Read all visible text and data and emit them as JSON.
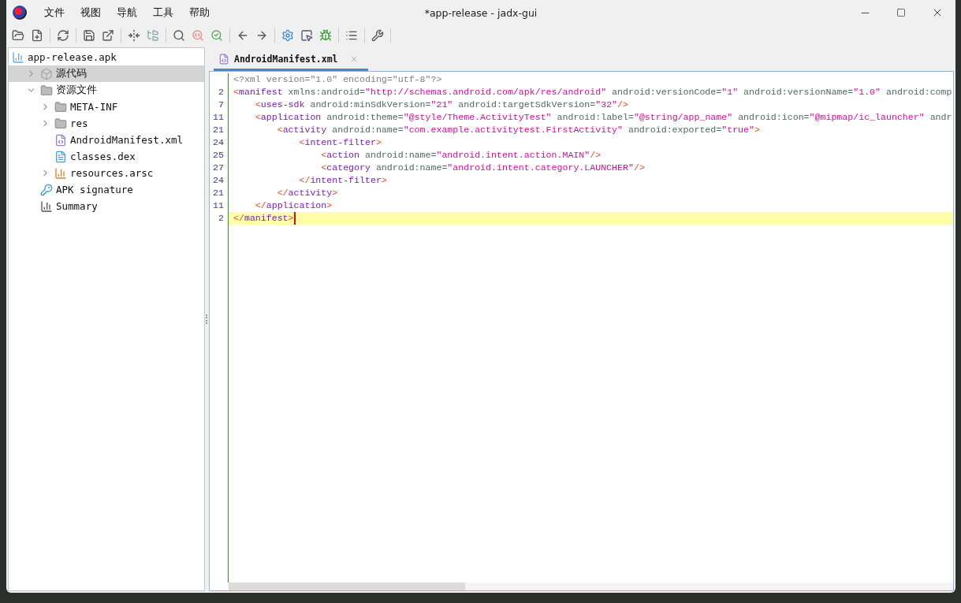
{
  "window": {
    "title": "*app-release - jadx-gui"
  },
  "menu": [
    "文件",
    "视图",
    "导航",
    "工具",
    "帮助"
  ],
  "tree": {
    "label": "app-release.apk",
    "kind": "apk",
    "children": [
      {
        "label": "源代码",
        "kind": "package",
        "expanded": false,
        "selected": true
      },
      {
        "label": "资源文件",
        "kind": "resources",
        "expanded": true,
        "selected": false,
        "children": [
          {
            "label": "META-INF",
            "kind": "folder",
            "expanded": false,
            "selected": false
          },
          {
            "label": "res",
            "kind": "folder",
            "expanded": false,
            "selected": false
          },
          {
            "label": "AndroidManifest.xml",
            "kind": "manifest",
            "selected": false
          },
          {
            "label": "classes.dex",
            "kind": "dex",
            "selected": false
          },
          {
            "label": "resources.arsc",
            "kind": "arsc",
            "expanded": false,
            "selected": false
          }
        ]
      },
      {
        "label": "APK signature",
        "kind": "signature",
        "selected": false
      },
      {
        "label": "Summary",
        "kind": "summary",
        "selected": false
      }
    ]
  },
  "tabs": [
    {
      "label": "AndroidManifest.xml",
      "selected": true
    }
  ],
  "code_lines": [
    {
      "tokens": [
        {
          "kind": "decl",
          "text": "<?xml version=\"1.0\" encoding=\"utf-8\"?>"
        }
      ],
      "current": false
    },
    {
      "number": "2",
      "tokens": [
        {
          "kind": "punct",
          "text": "<"
        },
        {
          "kind": "tag",
          "text": "manifest"
        },
        {
          "kind": "attr",
          "text": " xmlns:android="
        },
        {
          "kind": "value",
          "text": "\"http://schemas.android.com/apk/res/android\""
        },
        {
          "kind": "attr",
          "text": " android:versionCode="
        },
        {
          "kind": "value",
          "text": "\"1\""
        },
        {
          "kind": "attr",
          "text": " android:versionName="
        },
        {
          "kind": "value",
          "text": "\"1.0\""
        },
        {
          "kind": "attr",
          "text": " android:comp"
        }
      ],
      "current": false
    },
    {
      "number": "7",
      "tokens": [
        {
          "kind": "punct",
          "text": "    <"
        },
        {
          "kind": "tag",
          "text": "uses-sdk"
        },
        {
          "kind": "attr",
          "text": " android:minSdkVersion="
        },
        {
          "kind": "value",
          "text": "\"21\""
        },
        {
          "kind": "attr",
          "text": " android:targetSdkVersion="
        },
        {
          "kind": "value",
          "text": "\"32\""
        },
        {
          "kind": "punct",
          "text": "/>"
        }
      ],
      "current": false
    },
    {
      "number": "11",
      "tokens": [
        {
          "kind": "punct",
          "text": "    <"
        },
        {
          "kind": "tag",
          "text": "application"
        },
        {
          "kind": "attr",
          "text": " android:theme="
        },
        {
          "kind": "value",
          "text": "\"@style/Theme.ActivityTest\""
        },
        {
          "kind": "attr",
          "text": " android:label="
        },
        {
          "kind": "value",
          "text": "\"@string/app_name\""
        },
        {
          "kind": "attr",
          "text": " android:icon="
        },
        {
          "kind": "value",
          "text": "\"@mipmap/ic_launcher\""
        },
        {
          "kind": "attr",
          "text": " andr"
        }
      ],
      "current": false
    },
    {
      "number": "21",
      "tokens": [
        {
          "kind": "punct",
          "text": "        <"
        },
        {
          "kind": "tag",
          "text": "activity"
        },
        {
          "kind": "attr",
          "text": " android:name="
        },
        {
          "kind": "value",
          "text": "\"com.example.activitytest.FirstActivity\""
        },
        {
          "kind": "attr",
          "text": " android:exported="
        },
        {
          "kind": "value",
          "text": "\"true\""
        },
        {
          "kind": "punct",
          "text": ">"
        }
      ],
      "current": false
    },
    {
      "number": "24",
      "tokens": [
        {
          "kind": "punct",
          "text": "            <"
        },
        {
          "kind": "tag",
          "text": "intent-filter"
        },
        {
          "kind": "punct",
          "text": ">"
        }
      ],
      "current": false
    },
    {
      "number": "25",
      "tokens": [
        {
          "kind": "punct",
          "text": "                <"
        },
        {
          "kind": "tag",
          "text": "action"
        },
        {
          "kind": "attr",
          "text": " android:name="
        },
        {
          "kind": "value",
          "text": "\"android.intent.action.MAIN\""
        },
        {
          "kind": "punct",
          "text": "/>"
        }
      ],
      "current": false
    },
    {
      "number": "27",
      "tokens": [
        {
          "kind": "punct",
          "text": "                <"
        },
        {
          "kind": "tag",
          "text": "category"
        },
        {
          "kind": "attr",
          "text": " android:name="
        },
        {
          "kind": "value",
          "text": "\"android.intent.category.LAUNCHER\""
        },
        {
          "kind": "punct",
          "text": "/>"
        }
      ],
      "current": false
    },
    {
      "number": "24",
      "tokens": [
        {
          "kind": "punct",
          "text": "            </"
        },
        {
          "kind": "tag",
          "text": "intent-filter"
        },
        {
          "kind": "punct",
          "text": ">"
        }
      ],
      "current": false
    },
    {
      "number": "21",
      "tokens": [
        {
          "kind": "punct",
          "text": "        </"
        },
        {
          "kind": "tag",
          "text": "activity"
        },
        {
          "kind": "punct",
          "text": ">"
        }
      ],
      "current": false
    },
    {
      "number": "11",
      "tokens": [
        {
          "kind": "punct",
          "text": "    </"
        },
        {
          "kind": "tag",
          "text": "application"
        },
        {
          "kind": "punct",
          "text": ">"
        }
      ],
      "current": false
    },
    {
      "number": "2",
      "tokens": [
        {
          "kind": "punct",
          "text": "</"
        },
        {
          "kind": "tag",
          "text": "manifest"
        },
        {
          "kind": "punct",
          "text": ">"
        }
      ],
      "current": true
    }
  ]
}
